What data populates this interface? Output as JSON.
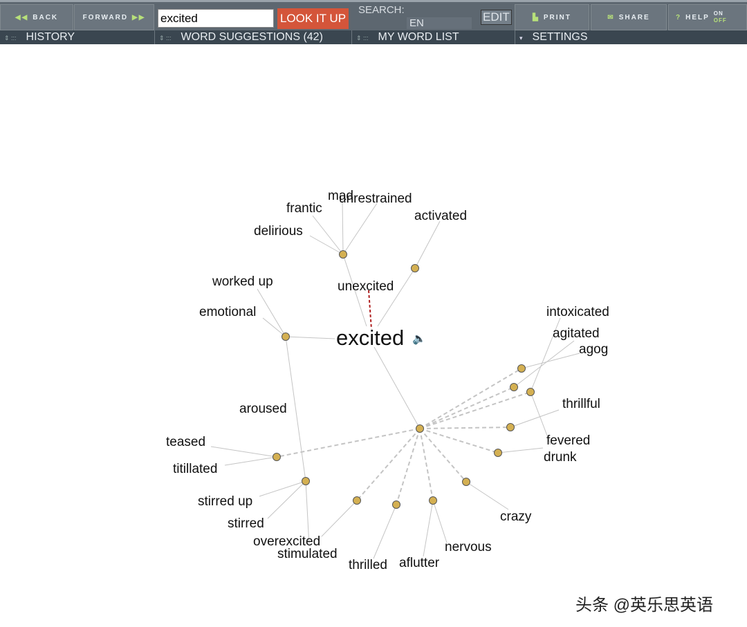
{
  "toolbar": {
    "back": "BACK",
    "forward": "FORWARD",
    "query": "excited",
    "look_it_up": "LOOK IT UP",
    "search_label": "SEARCH:",
    "search_lang": "EN",
    "edit": "EDIT",
    "print": "PRINT",
    "share": "SHARE",
    "help": "HELP",
    "on": "ON",
    "off": "OFF"
  },
  "panels": {
    "history": "HISTORY",
    "suggestions": "WORD SUGGESTIONS (42)",
    "word_list": "MY WORD LIST",
    "settings": "SETTINGS"
  },
  "graph": {
    "center": "excited",
    "antonym": "unexcited",
    "words": [
      "mad",
      "unrestrained",
      "frantic",
      "delirious",
      "activated",
      "worked up",
      "emotional",
      "aroused",
      "teased",
      "titillated",
      "stirred up",
      "stirred",
      "overexcited",
      "stimulated",
      "thrilled",
      "aflutter",
      "nervous",
      "crazy",
      "drunk",
      "fevered",
      "thrillful",
      "agog",
      "agitated",
      "intoxicated"
    ],
    "colors": {
      "node": "#d4b052",
      "line": "#c4c4c4",
      "antonym_line": "#b02020"
    }
  },
  "watermark": "头条 @英乐思英语"
}
